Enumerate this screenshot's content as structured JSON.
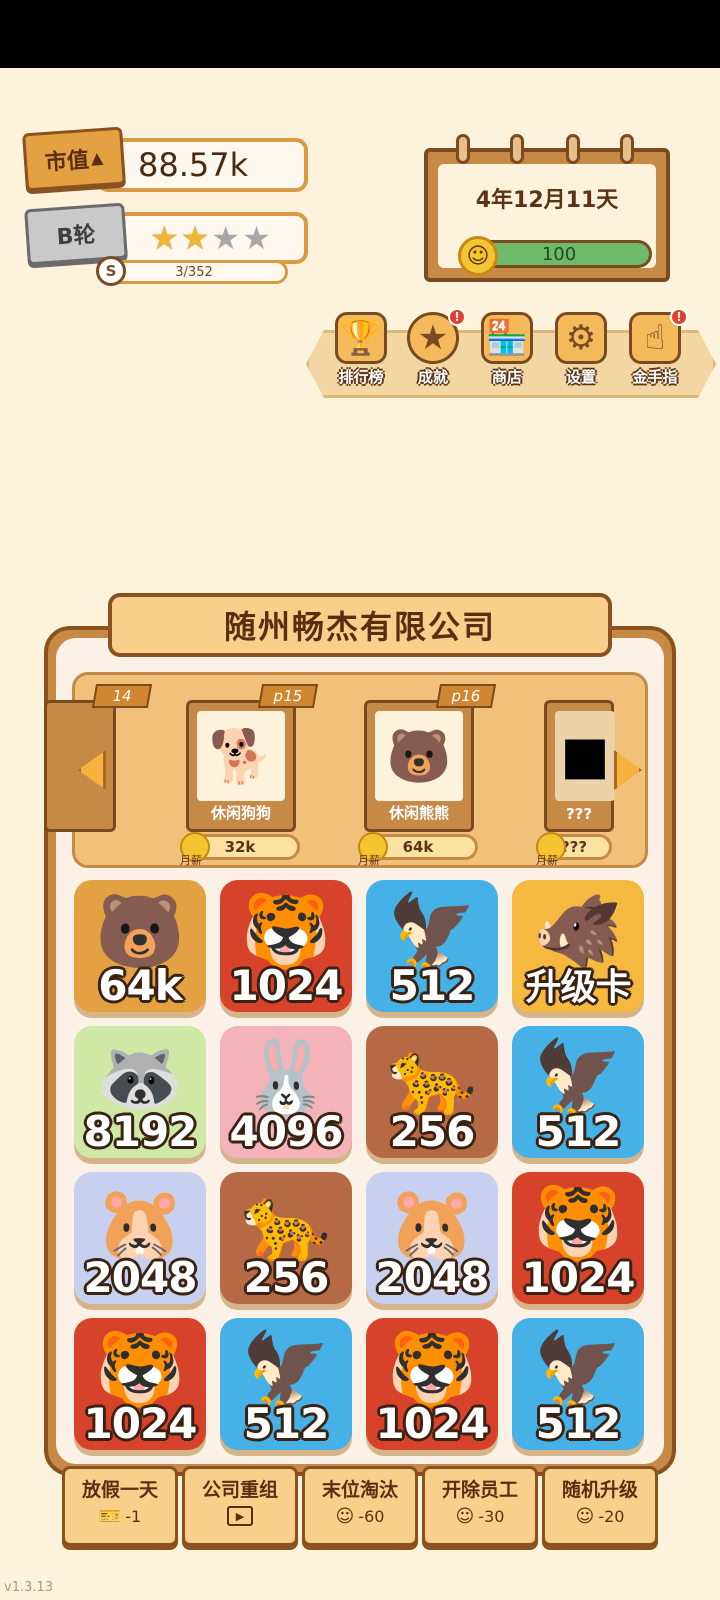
{
  "stats": {
    "market_value_label": "市值",
    "market_value": "88.57k",
    "round_label": "B轮",
    "stars_filled": 2,
    "stars_total": 4,
    "progress_prefix": "S",
    "progress_text": "3/352"
  },
  "calendar": {
    "date": "4年12月11天",
    "mood_value": "100"
  },
  "menu": [
    {
      "label": "排行榜",
      "icon": "trophy-icon",
      "badge": false
    },
    {
      "label": "成就",
      "icon": "medal-icon",
      "badge": true
    },
    {
      "label": "商店",
      "icon": "shop-icon",
      "badge": false
    },
    {
      "label": "设置",
      "icon": "gear-icon",
      "badge": false
    },
    {
      "label": "金手指",
      "icon": "finger-icon",
      "badge": true
    }
  ],
  "badge_mark": "!",
  "company": {
    "name": "随州畅杰有限公司"
  },
  "carousel": {
    "month_label": "月薪",
    "cards": [
      {
        "page": "14",
        "name": "",
        "salary": ""
      },
      {
        "page": "p15",
        "name": "休闲狗狗",
        "salary": "32k",
        "icon": "dog-icon"
      },
      {
        "page": "p16",
        "name": "休闲熊熊",
        "salary": "64k",
        "icon": "bear-icon"
      },
      {
        "page": "",
        "name": "???",
        "salary": "???",
        "icon": "silhouette-icon"
      }
    ]
  },
  "grid": [
    {
      "value": "64k",
      "animal": "bear",
      "color": "#e3a142"
    },
    {
      "value": "1024",
      "animal": "tiger",
      "color": "#d7432a"
    },
    {
      "value": "512",
      "animal": "eagle",
      "color": "#46b1e6"
    },
    {
      "value": "升级卡",
      "animal": "boar",
      "color": "#f4b93e"
    },
    {
      "value": "8192",
      "animal": "red-panda",
      "color": "#cfe8a6"
    },
    {
      "value": "4096",
      "animal": "rabbit",
      "color": "#f3b3b8"
    },
    {
      "value": "256",
      "animal": "leopard",
      "color": "#b56a45"
    },
    {
      "value": "512",
      "animal": "eagle",
      "color": "#46b1e6"
    },
    {
      "value": "2048",
      "animal": "hamster",
      "color": "#c7d0ee"
    },
    {
      "value": "256",
      "animal": "leopard",
      "color": "#b56a45"
    },
    {
      "value": "2048",
      "animal": "hamster",
      "color": "#c7d0ee"
    },
    {
      "value": "1024",
      "animal": "tiger",
      "color": "#d7432a"
    },
    {
      "value": "1024",
      "animal": "tiger",
      "color": "#d7432a"
    },
    {
      "value": "512",
      "animal": "eagle",
      "color": "#46b1e6"
    },
    {
      "value": "1024",
      "animal": "tiger",
      "color": "#d7432a"
    },
    {
      "value": "512",
      "animal": "eagle",
      "color": "#46b1e6"
    }
  ],
  "actions": [
    {
      "label": "放假一天",
      "cost": "-1",
      "icon": "ticket-icon"
    },
    {
      "label": "公司重组",
      "cost": "",
      "icon": "video-icon"
    },
    {
      "label": "末位淘汰",
      "cost": "-60",
      "icon": "smile-icon"
    },
    {
      "label": "开除员工",
      "cost": "-30",
      "icon": "smile-icon"
    },
    {
      "label": "随机升级",
      "cost": "-20",
      "icon": "smile-icon"
    }
  ],
  "version": "v1.3.13"
}
